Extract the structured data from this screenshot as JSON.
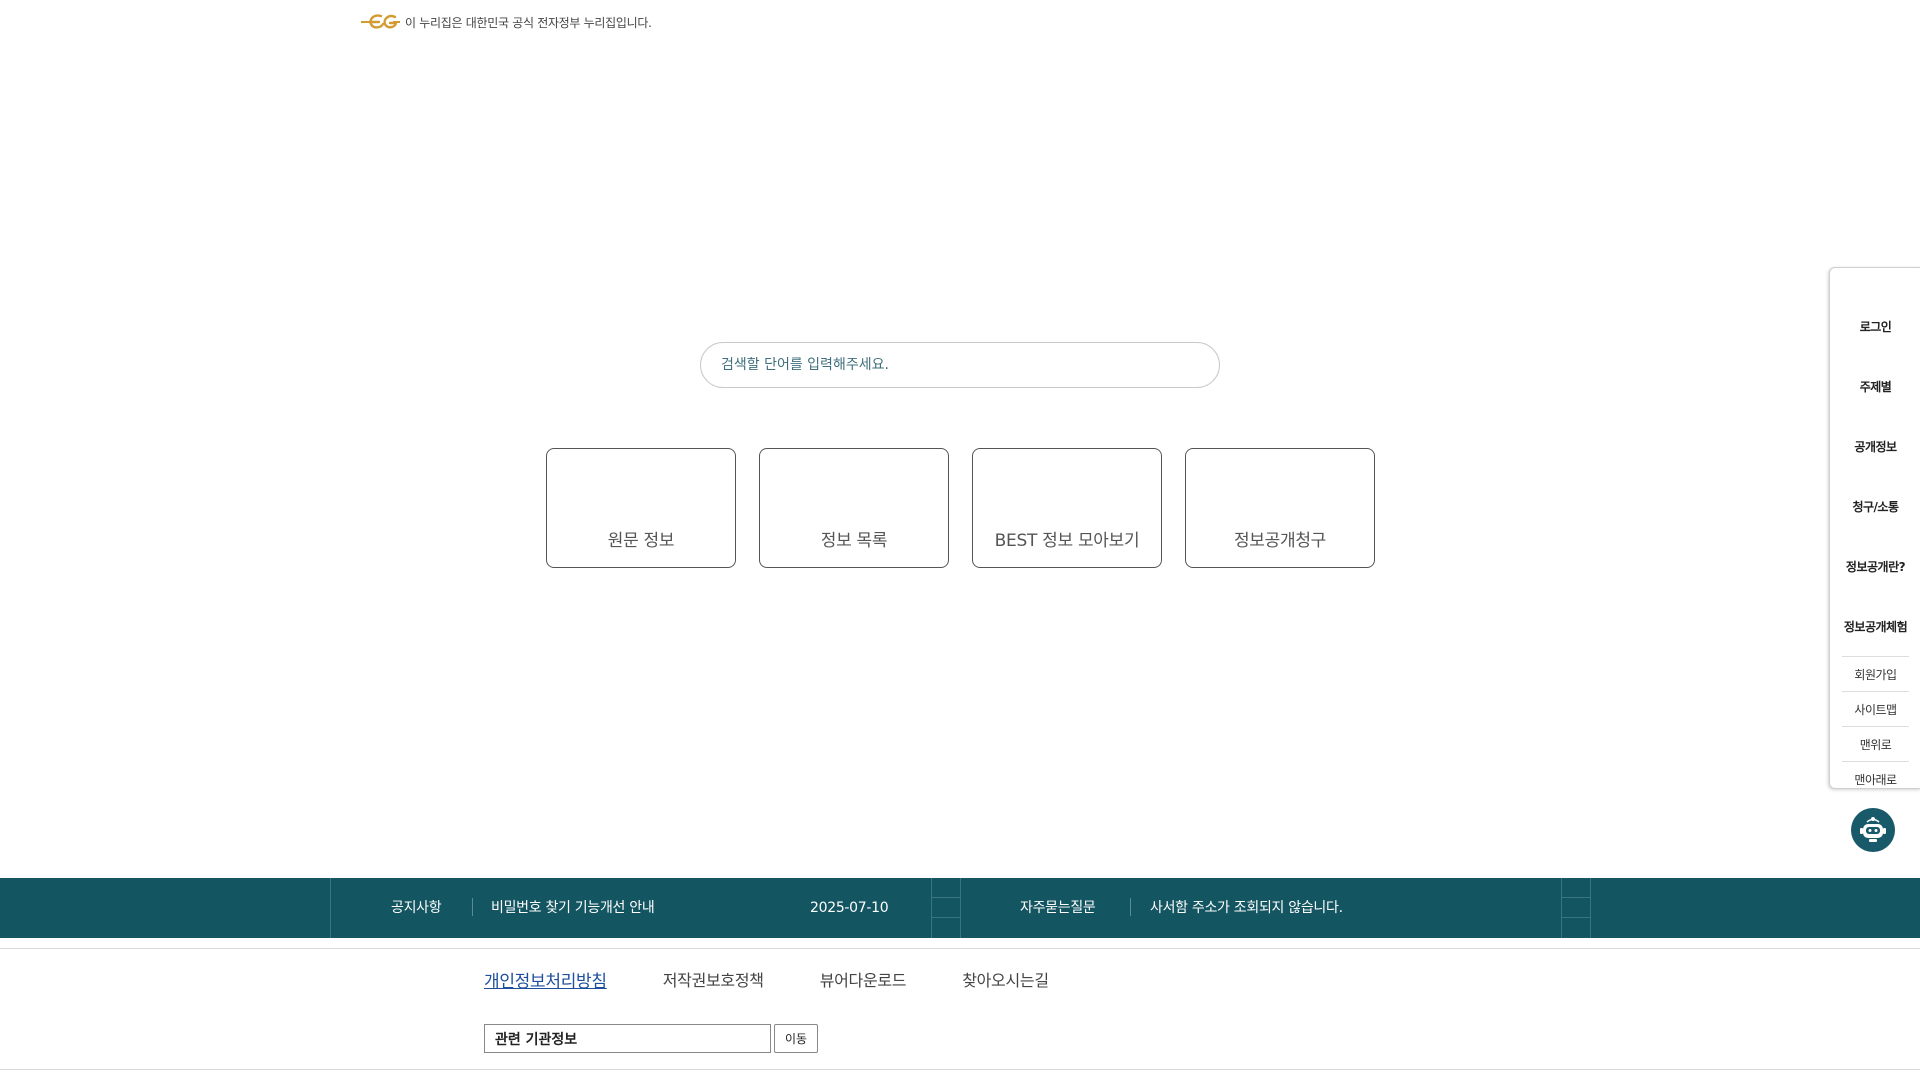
{
  "banner": {
    "text": "이 누리집은 대한민국 공식 전자정부 누리집입니다.",
    "logo_icon": "egov-logo-icon",
    "logo_color": "#d39b33"
  },
  "search": {
    "placeholder": "검색할 단어를 입력해주세요."
  },
  "tiles": [
    {
      "label": "원문 정보"
    },
    {
      "label": "정보 목록"
    },
    {
      "label": "BEST 정보 모아보기"
    },
    {
      "label": "정보공개청구"
    }
  ],
  "side_menu": {
    "items": [
      "로그인",
      "주제별",
      "공개정보",
      "청구/소통",
      "정보공개란?",
      "정보공개체험"
    ],
    "sub_items": [
      "회원가입",
      "사이트맵",
      "맨위로",
      "맨아래로"
    ]
  },
  "chatbot": {
    "icon": "chatbot-icon",
    "color": "#18596a"
  },
  "notice_bar": {
    "color": "#145562",
    "notice_label": "공지사항",
    "notice_title": "비밀번호 찾기 기능개선 안내",
    "notice_date": "2025-07-10",
    "faq_label": "자주묻는질문",
    "faq_title": "사서함 주소가 조회되지 않습니다."
  },
  "footer": {
    "links": [
      "개인정보처리방침",
      "저작권보호정책",
      "뷰어다운로드",
      "찾아오시는길"
    ],
    "related_select": "관련 기관정보",
    "go_button": "이동"
  }
}
